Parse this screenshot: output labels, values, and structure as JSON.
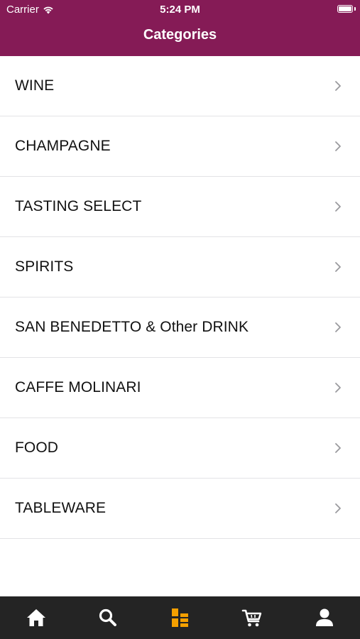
{
  "status_bar": {
    "carrier": "Carrier",
    "time": "5:24 PM"
  },
  "header": {
    "title": "Categories",
    "background_color": "#851b56"
  },
  "categories": [
    {
      "label": "WINE"
    },
    {
      "label": "CHAMPAGNE"
    },
    {
      "label": "TASTING SELECT"
    },
    {
      "label": "SPIRITS"
    },
    {
      "label": "SAN BENEDETTO & Other DRINK"
    },
    {
      "label": "CAFFE MOLINARI"
    },
    {
      "label": "FOOD"
    },
    {
      "label": "TABLEWARE"
    }
  ],
  "tab_bar": {
    "background_color": "#242424",
    "active_color": "#f5a000",
    "inactive_color": "#ffffff",
    "tabs": [
      {
        "icon": "home-icon",
        "active": false
      },
      {
        "icon": "search-icon",
        "active": false
      },
      {
        "icon": "categories-icon",
        "active": true
      },
      {
        "icon": "cart-icon",
        "active": false
      },
      {
        "icon": "profile-icon",
        "active": false
      }
    ]
  }
}
